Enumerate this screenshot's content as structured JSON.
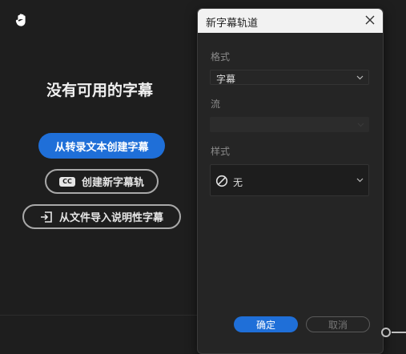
{
  "panel": {
    "empty_title": "没有可用的字幕",
    "btn_transcribe": "从转录文本创建字幕",
    "btn_create_track": "创建新字幕轨",
    "btn_import_file": "从文件导入说明性字幕",
    "cc_icon_text": "CC",
    "accent": "#1f6fd8"
  },
  "dialog": {
    "title": "新字幕轨道",
    "format_label": "格式",
    "format_value": "字幕",
    "stream_label": "流",
    "stream_value": "",
    "style_label": "样式",
    "style_value": "无",
    "ok_label": "确定",
    "cancel_label": "取消"
  },
  "icons": [
    "hand-icon",
    "cc-icon",
    "import-icon",
    "close-icon",
    "chevron-down-icon",
    "no-style-icon"
  ]
}
